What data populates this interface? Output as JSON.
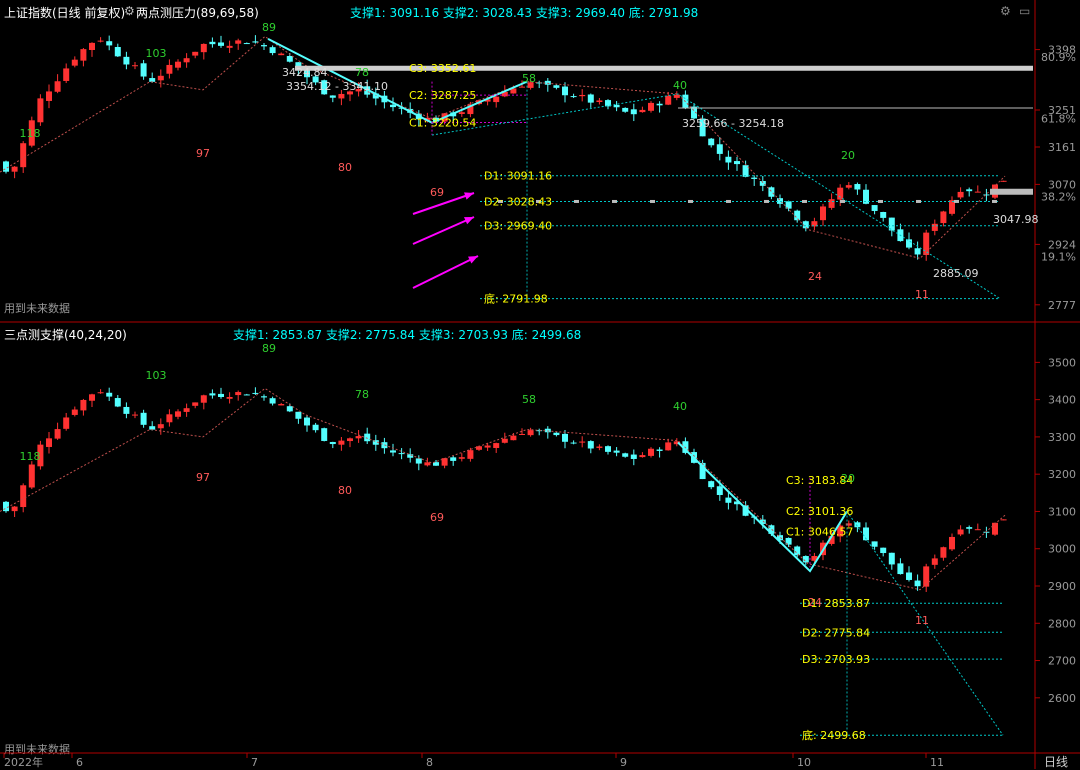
{
  "colors": {
    "up": "#ff3232",
    "down": "#54ffff",
    "wave_label": "#2fcf2f",
    "low_label": "#ff5a5a",
    "level_text": "#ffff00",
    "arrow": "#ff00ff",
    "axis_text": "#9a9a9a",
    "header_text": "#ffffff",
    "indicator_text": "#00ffff",
    "grid": "#222222"
  },
  "top_panel": {
    "title": "上证指数(日线 前复权)",
    "indicator_name": "两点测压力(89,69,58)",
    "indicator_values": "支撑1: 3091.16 支撑2: 3028.43 支撑3: 2969.40 底: 2791.98",
    "future_note": "用到未来数据",
    "y_ticks": [
      "3398",
      "3251",
      "3161",
      "3070",
      "2924",
      "2777"
    ],
    "pct_ticks": [
      "80.9%",
      "61.8%",
      "38.2%",
      "19.1%"
    ],
    "wave_labels": [
      "118",
      "103",
      "89",
      "78",
      "58",
      "40",
      "20"
    ],
    "low_labels": [
      "97",
      "80",
      "69",
      "24",
      "11"
    ],
    "level_labels": {
      "C3": "C3: 3352.61",
      "C2": "C2: 3287.25",
      "C1": "C1: 3220.54",
      "D1": "D1: 3091.16",
      "D2": "D2: 3028.43",
      "D3": "D3: 2969.40",
      "bottom": "底: 2791.98"
    },
    "price_annotations": {
      "high": "3424.84",
      "range1": "3354.12 - 3341.10",
      "range2": "3259.66 - 3254.18",
      "low": "2885.09",
      "last": "3047.98"
    }
  },
  "bottom_panel": {
    "indicator_name": "三点测支撑(40,24,20)",
    "indicator_values": "支撑1: 2853.87 支撑2: 2775.84 支撑3: 2703.93 底: 2499.68",
    "future_note": "用到未来数据",
    "y_ticks": [
      "3500",
      "3400",
      "3300",
      "3200",
      "3100",
      "3000",
      "2900",
      "2800",
      "2700",
      "2600"
    ],
    "wave_labels": [
      "118",
      "103",
      "89",
      "78",
      "58",
      "40",
      "20"
    ],
    "low_labels": [
      "97",
      "80",
      "69",
      "24",
      "11"
    ],
    "level_labels": {
      "C3": "C3: 3183.84",
      "C2": "C2: 3101.36",
      "C1": "C1: 3046.57",
      "D1": "D1: 2853.87",
      "D2": "D2: 2775.84",
      "D3": "D3: 2703.93",
      "bottom": "底: 2499.68"
    }
  },
  "x_axis": {
    "labels": [
      "2022年",
      "6",
      "7",
      "8",
      "9",
      "10",
      "11"
    ],
    "period": "日线"
  },
  "chart_data": [
    {
      "type": "candlestick",
      "title": "上证指数(日线 前复权)",
      "indicator": "两点测压力(89,69,58)",
      "ylim": [
        2740,
        3470
      ],
      "levels": {
        "C3": 3352.61,
        "C2": 3287.25,
        "C1": 3220.54,
        "D1": 3091.16,
        "D2": 3028.43,
        "D3": 2969.4,
        "bottom": 2791.98
      },
      "pct_levels": [
        [
          "80.9%",
          3380
        ],
        [
          "61.8%",
          3230
        ],
        [
          "38.2%",
          3040
        ],
        [
          "19.1%",
          2895
        ]
      ],
      "annotated_prices": {
        "high": 3424.84,
        "low": 2885.09,
        "last": 3047.98
      }
    },
    {
      "type": "candlestick",
      "title": "三点测支撑(40,24,20)",
      "ylim": [
        2460,
        3560
      ],
      "levels": {
        "C3": 3183.84,
        "C2": 3101.36,
        "C1": 3046.57,
        "D1": 2853.87,
        "D2": 2775.84,
        "D3": 2703.93,
        "bottom": 2499.68
      }
    }
  ]
}
